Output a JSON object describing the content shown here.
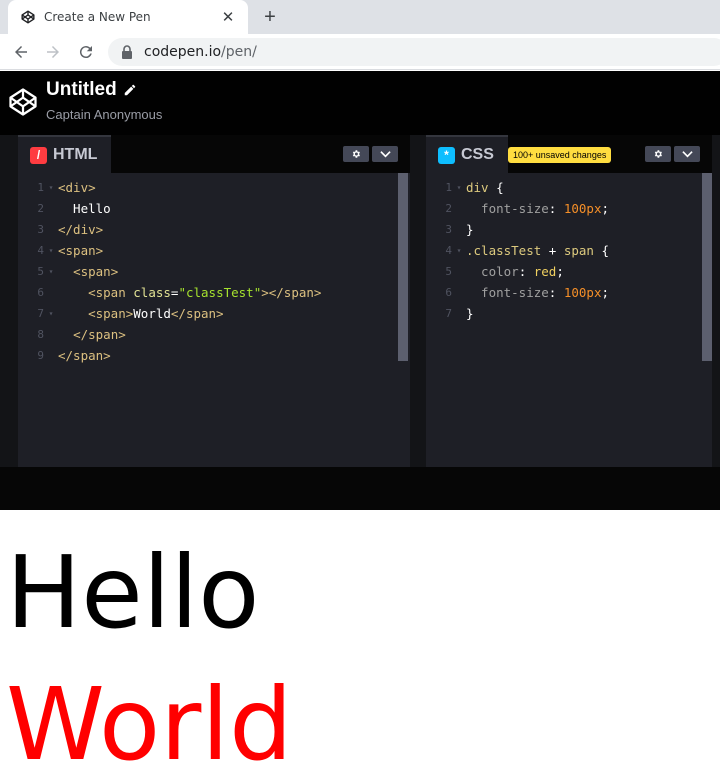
{
  "browser": {
    "tab_title": "Create a New Pen",
    "url_domain": "codepen.io",
    "url_path": "/pen/"
  },
  "header": {
    "title": "Untitled",
    "owner": "Captain Anonymous"
  },
  "html_editor": {
    "label": "HTML",
    "icon_char": "/",
    "icon_color": "#ff3c41",
    "lines": [
      {
        "n": "1",
        "fold": "▾",
        "parts": [
          [
            "tag",
            "<div>"
          ]
        ]
      },
      {
        "n": "2",
        "fold": "",
        "parts": [
          [
            "ptext",
            "  Hello"
          ]
        ]
      },
      {
        "n": "3",
        "fold": "",
        "parts": [
          [
            "tag",
            "</div>"
          ]
        ]
      },
      {
        "n": "4",
        "fold": "▾",
        "parts": [
          [
            "tag",
            "<span>"
          ]
        ]
      },
      {
        "n": "5",
        "fold": "▾",
        "parts": [
          [
            "ptext",
            "  "
          ],
          [
            "tag",
            "<span>"
          ]
        ]
      },
      {
        "n": "6",
        "fold": "",
        "parts": [
          [
            "ptext",
            "    "
          ],
          [
            "tag",
            "<span "
          ],
          [
            "attr",
            "class"
          ],
          [
            "ptext",
            "="
          ],
          [
            "str",
            "\"classTest\""
          ],
          [
            "tag",
            "></span>"
          ]
        ]
      },
      {
        "n": "7",
        "fold": "▾",
        "parts": [
          [
            "ptext",
            "    "
          ],
          [
            "tag",
            "<span>"
          ],
          [
            "ptext",
            "World"
          ],
          [
            "tag",
            "</span>"
          ]
        ]
      },
      {
        "n": "8",
        "fold": "",
        "parts": [
          [
            "ptext",
            "  "
          ],
          [
            "tag",
            "</span>"
          ]
        ]
      },
      {
        "n": "9",
        "fold": "",
        "parts": [
          [
            "tag",
            "</span>"
          ]
        ]
      }
    ]
  },
  "css_editor": {
    "label": "CSS",
    "icon_char": "*",
    "icon_color": "#0ebeff",
    "badge": "100+ unsaved changes",
    "lines": [
      {
        "n": "1",
        "fold": "▾",
        "parts": [
          [
            "sel",
            "div "
          ],
          [
            "punc",
            "{"
          ]
        ]
      },
      {
        "n": "2",
        "fold": "",
        "parts": [
          [
            "prop",
            "  font-size"
          ],
          [
            "punc",
            ": "
          ],
          [
            "num",
            "100px"
          ],
          [
            "punc",
            ";"
          ]
        ]
      },
      {
        "n": "3",
        "fold": "",
        "parts": [
          [
            "punc",
            "}"
          ]
        ]
      },
      {
        "n": "4",
        "fold": "▾",
        "parts": [
          [
            "sel",
            ".classTest "
          ],
          [
            "punc",
            "+ "
          ],
          [
            "sel",
            "span "
          ],
          [
            "punc",
            "{"
          ]
        ]
      },
      {
        "n": "5",
        "fold": "",
        "parts": [
          [
            "prop",
            "  color"
          ],
          [
            "punc",
            ": "
          ],
          [
            "kw",
            "red"
          ],
          [
            "punc",
            ";"
          ]
        ]
      },
      {
        "n": "6",
        "fold": "",
        "parts": [
          [
            "prop",
            "  font-size"
          ],
          [
            "punc",
            ": "
          ],
          [
            "num",
            "100px"
          ],
          [
            "punc",
            ";"
          ]
        ]
      },
      {
        "n": "7",
        "fold": "",
        "parts": [
          [
            "punc",
            "}"
          ]
        ]
      }
    ]
  },
  "preview": {
    "line1": "Hello",
    "line2": "World",
    "line2_color": "#ff0000"
  }
}
